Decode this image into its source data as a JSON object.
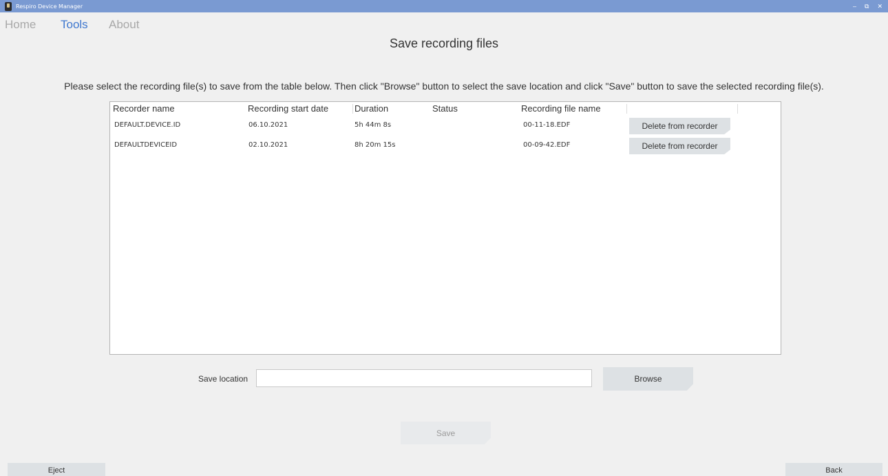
{
  "window": {
    "title": "Respiro Device Manager",
    "controls": {
      "minimize": "–",
      "restore": "⧉",
      "close": "✕"
    }
  },
  "menu": {
    "items": [
      {
        "label": "Home",
        "active": false
      },
      {
        "label": "Tools",
        "active": true
      },
      {
        "label": "About",
        "active": false
      }
    ]
  },
  "page": {
    "title": "Save recording files",
    "instructions": "Please select the recording file(s) to save from the table below. Then click \"Browse\" button to select the save location and click \"Save\" button to save the selected recording file(s)."
  },
  "table": {
    "headers": {
      "recorder_name": "Recorder name",
      "start_date": "Recording start date",
      "duration": "Duration",
      "status": "Status",
      "file_name": "Recording file name"
    },
    "rows": [
      {
        "recorder_name": "DEFAULT.DEVICE.ID",
        "start_date": "06.10.2021",
        "duration": "5h  44m  8s",
        "status": "",
        "file_name": "00-11-18.EDF",
        "action": "Delete from recorder"
      },
      {
        "recorder_name": "DEFAULTDEVICEID",
        "start_date": "02.10.2021",
        "duration": "8h  20m  15s",
        "status": "",
        "file_name": "00-09-42.EDF",
        "action": "Delete from recorder"
      }
    ]
  },
  "save_location": {
    "label": "Save location",
    "value": "",
    "placeholder": ""
  },
  "buttons": {
    "browse": "Browse",
    "save": "Save",
    "eject": "Eject",
    "back": "Back"
  },
  "colors": {
    "titlebar": "#7a9ad2",
    "active_menu": "#3f78cf",
    "inactive_menu": "#a8a8a8",
    "button_bg": "#dde1e4"
  }
}
